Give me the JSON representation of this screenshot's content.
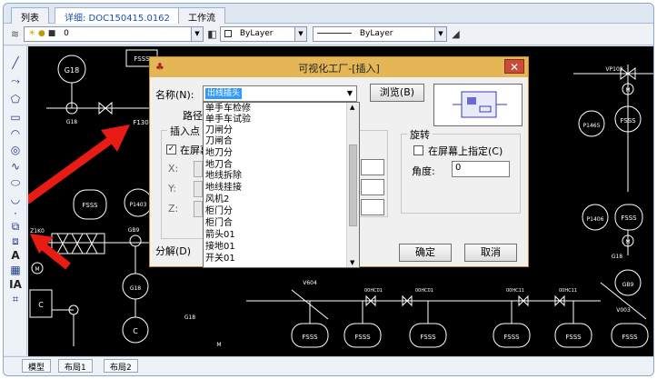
{
  "tabs": [
    {
      "label": "列表"
    },
    {
      "label": "详细: DOC150415.0162"
    },
    {
      "label": "工作流"
    }
  ],
  "toolbar": {
    "layer_value": "0",
    "color_value": "ByLayer",
    "linetype_value": "ByLayer"
  },
  "drawing_labels": {
    "fsss": "FSSS",
    "g1": "G18",
    "g2": "G18",
    "f130": "F130",
    "gb9": "GB9",
    "p1": "P1403",
    "p2": "P1465",
    "p3": "P1406",
    "vp102": "VP102",
    "v1": "V604",
    "v2": "V003",
    "ms1": "M",
    "ms2": "M",
    "ms3": "M",
    "ms4": "M",
    "small1": "G18",
    "c1": "C",
    "c2": "C",
    "z": "Z1K0",
    "b1": "00HC01",
    "b2": "00HC01",
    "b3": "00HC11",
    "b4": "00HC11",
    "g3": "G18",
    "g4": "G18",
    "g5": "GB9"
  },
  "bottom_tabs": [
    {
      "label": "模型"
    },
    {
      "label": "布局1"
    },
    {
      "label": "布局2"
    }
  ],
  "dialog": {
    "title": "可视化工厂-[插入]",
    "name_label": "名称(N):",
    "name_value": "出线插头",
    "browse_button": "浏览(B)",
    "path_label": "路径:",
    "insert_point_title": "插入点",
    "on_screen_label": "在屏幕",
    "x_label": "X:",
    "y_label": "Y:",
    "z_label": "Z:",
    "rotation_title": "旋转",
    "rotation_on_screen_label": "在屏幕上指定(C)",
    "angle_label": "角度:",
    "angle_value": "0",
    "explode_label": "分解(D)",
    "ok_button": "确定",
    "cancel_button": "取消",
    "dropdown_items": [
      {
        "label": "单手车检修"
      },
      {
        "label": "单手车试验"
      },
      {
        "label": "刀闸分"
      },
      {
        "label": "刀闸合"
      },
      {
        "label": "地刀分"
      },
      {
        "label": "地刀合"
      },
      {
        "label": "地线拆除"
      },
      {
        "label": "地线挂接"
      },
      {
        "label": "风机2"
      },
      {
        "label": "柜门分"
      },
      {
        "label": "柜门合"
      },
      {
        "label": "箭头01"
      },
      {
        "label": "接地01"
      },
      {
        "label": "开关01"
      }
    ]
  },
  "colors": {
    "accent_red": "#e81c14",
    "title_bar": "#e4b656",
    "highlight": "#3399ff"
  }
}
